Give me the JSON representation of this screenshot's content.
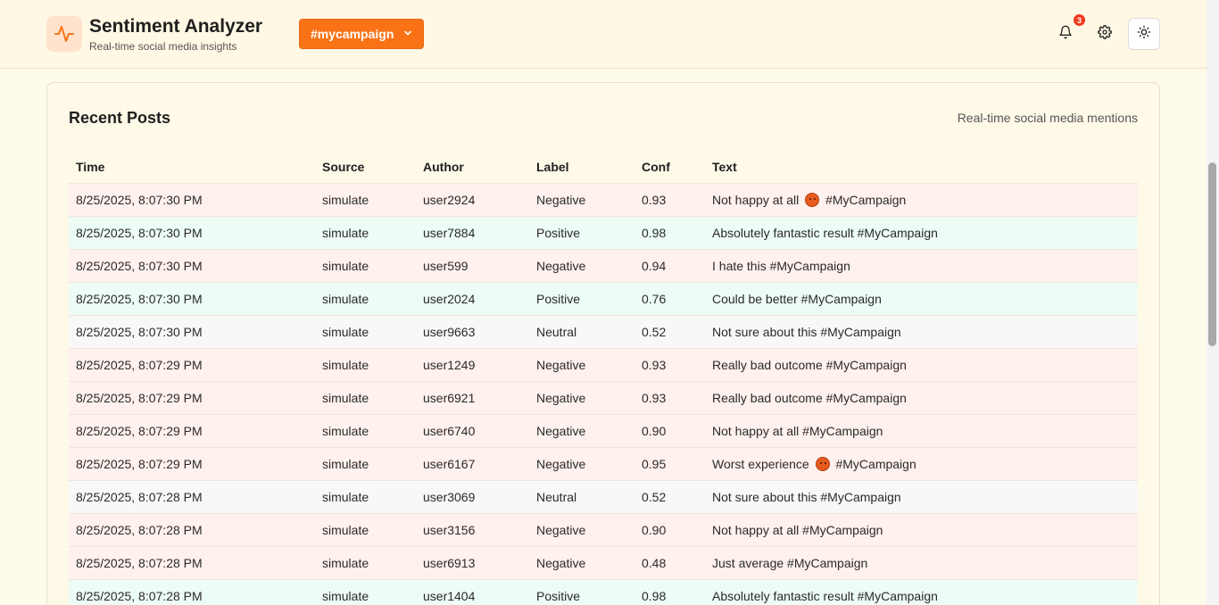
{
  "header": {
    "title": "Sentiment Analyzer",
    "subtitle": "Real-time social media insights",
    "campaign_label": "#mycampaign",
    "notification_count": "3",
    "logo_icon": "activity-pulse-icon"
  },
  "colors": {
    "accent": "#f97316",
    "negative_row": "#fff1ed",
    "positive_row": "#edfcf4",
    "neutral_row": "#f9f8f8"
  },
  "posts": {
    "title": "Recent Posts",
    "subtitle": "Real-time social media mentions",
    "columns": [
      "Time",
      "Source",
      "Author",
      "Label",
      "Conf",
      "Text"
    ],
    "rows": [
      {
        "time": "8/25/2025, 8:07:30 PM",
        "source": "simulate",
        "author": "user2924",
        "label": "Negative",
        "conf": "0.93",
        "text": "Not happy at all",
        "emoji": "angry-face",
        "tag": "#MyCampaign"
      },
      {
        "time": "8/25/2025, 8:07:30 PM",
        "source": "simulate",
        "author": "user7884",
        "label": "Positive",
        "conf": "0.98",
        "text": "Absolutely fantastic result #MyCampaign"
      },
      {
        "time": "8/25/2025, 8:07:30 PM",
        "source": "simulate",
        "author": "user599",
        "label": "Negative",
        "conf": "0.94",
        "text": "I hate this #MyCampaign"
      },
      {
        "time": "8/25/2025, 8:07:30 PM",
        "source": "simulate",
        "author": "user2024",
        "label": "Positive",
        "conf": "0.76",
        "text": "Could be better #MyCampaign"
      },
      {
        "time": "8/25/2025, 8:07:30 PM",
        "source": "simulate",
        "author": "user9663",
        "label": "Neutral",
        "conf": "0.52",
        "text": "Not sure about this #MyCampaign"
      },
      {
        "time": "8/25/2025, 8:07:29 PM",
        "source": "simulate",
        "author": "user1249",
        "label": "Negative",
        "conf": "0.93",
        "text": "Really bad outcome #MyCampaign"
      },
      {
        "time": "8/25/2025, 8:07:29 PM",
        "source": "simulate",
        "author": "user6921",
        "label": "Negative",
        "conf": "0.93",
        "text": "Really bad outcome #MyCampaign"
      },
      {
        "time": "8/25/2025, 8:07:29 PM",
        "source": "simulate",
        "author": "user6740",
        "label": "Negative",
        "conf": "0.90",
        "text": "Not happy at all #MyCampaign"
      },
      {
        "time": "8/25/2025, 8:07:29 PM",
        "source": "simulate",
        "author": "user6167",
        "label": "Negative",
        "conf": "0.95",
        "text": "Worst experience",
        "emoji": "angry-face",
        "tag": "#MyCampaign"
      },
      {
        "time": "8/25/2025, 8:07:28 PM",
        "source": "simulate",
        "author": "user3069",
        "label": "Neutral",
        "conf": "0.52",
        "text": "Not sure about this #MyCampaign"
      },
      {
        "time": "8/25/2025, 8:07:28 PM",
        "source": "simulate",
        "author": "user3156",
        "label": "Negative",
        "conf": "0.90",
        "text": "Not happy at all #MyCampaign"
      },
      {
        "time": "8/25/2025, 8:07:28 PM",
        "source": "simulate",
        "author": "user6913",
        "label": "Negative",
        "conf": "0.48",
        "text": "Just average #MyCampaign"
      },
      {
        "time": "8/25/2025, 8:07:28 PM",
        "source": "simulate",
        "author": "user1404",
        "label": "Positive",
        "conf": "0.98",
        "text": "Absolutely fantastic result #MyCampaign"
      }
    ]
  }
}
